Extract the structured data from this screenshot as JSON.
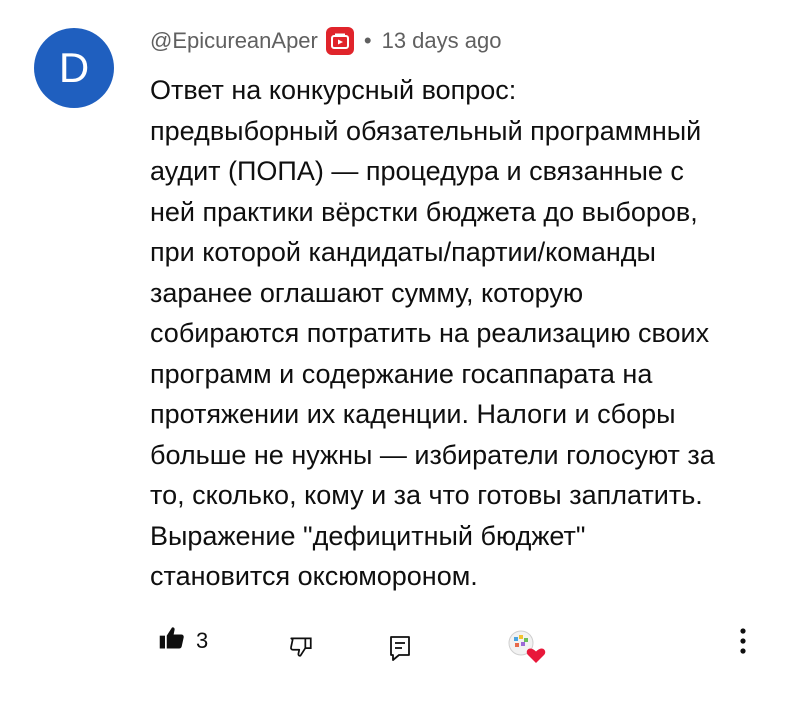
{
  "comment": {
    "avatar_letter": "D",
    "author": "@EpicureanAper",
    "separator": "•",
    "timestamp": "13 days ago",
    "text": "Ответ на конкурсный вопрос:\nпредвыборный обязательный программный\nаудит (ПОПА) — процедура и связанные с\nней практики вёрстки бюджета до выборов,\nпри которой кандидаты/партии/команды\nзаранее оглашают сумму, которую\nсобираются потратить на реализацию своих\nпрограмм и содержание госаппарата на\nпротяжении их каденции. Налоги и сборы\nбольше не нужны — избиратели голосуют за\nто, сколько, кому и за что готовы заплатить.\nВыражение \"дефицитный бюджет\"\nстановится оксюмороном."
  },
  "actions": {
    "like_count": "3",
    "icons": [
      "thumbs-up-icon",
      "thumbs-down-icon",
      "reply-icon",
      "creator-heart-icon",
      "more-vert-icon"
    ]
  },
  "colors": {
    "avatar_bg": "#1f5fbf",
    "badge_red": "#e0242b",
    "meta_gray": "#606060",
    "heart_red": "#e8183a"
  }
}
